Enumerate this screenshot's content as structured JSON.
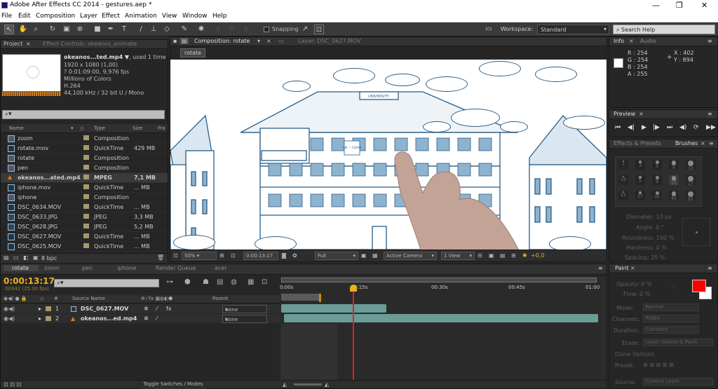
{
  "window": {
    "title": "Adobe After Effects CC 2014 - gestures.aep *",
    "min": "—",
    "max": "❐",
    "close": "✕"
  },
  "menu": [
    "File",
    "Edit",
    "Composition",
    "Layer",
    "Effect",
    "Animation",
    "View",
    "Window",
    "Help"
  ],
  "toolbar": {
    "snapping": "Snapping",
    "workspace_label": "Workspace:",
    "workspace_value": "Standard",
    "search_placeholder": "Search Help"
  },
  "project": {
    "tab": "Project",
    "tab2": "Effect Controls: okeanos_animate",
    "preview_name": "okeanos...ted.mp4 ▼",
    ",used": ", used 1 time",
    "info_lines": [
      "1920 x 1080 (1,00)",
      "? 0:01:09:00, 9,976 fps",
      "Millions of Colors",
      "H.264",
      "44,100 kHz / 32 bit U / Mono"
    ],
    "search_placeholder": "⌕▾",
    "headers": {
      "name": "Name",
      "type": "Type",
      "size": "Size",
      "frame": "Fra"
    },
    "items": [
      {
        "name": "zoom",
        "type": "Composition",
        "size": "",
        "icon": "comp",
        "color": "#a69a6a"
      },
      {
        "name": "rotate.mov",
        "type": "QuickTime",
        "size": "429 MB",
        "icon": "file",
        "color": "#a69a6a"
      },
      {
        "name": "rotate",
        "type": "Composition",
        "size": "",
        "icon": "comp",
        "color": "#a69a6a"
      },
      {
        "name": "pen",
        "type": "Composition",
        "size": "",
        "icon": "comp",
        "color": "#a69a6a"
      },
      {
        "name": "okeanos...ated.mp4",
        "type": "MPEG",
        "size": "7,1 MB",
        "icon": "vlc",
        "color": "#a69a6a"
      },
      {
        "name": "iphone.mov",
        "type": "QuickTime",
        "size": "... MB",
        "icon": "file",
        "color": "#a69a6a"
      },
      {
        "name": "iphone",
        "type": "Composition",
        "size": "",
        "icon": "comp",
        "color": "#a69a6a"
      },
      {
        "name": "DSC_0634.MOV",
        "type": "QuickTime",
        "size": "... MB",
        "icon": "file",
        "color": "#a69a6a"
      },
      {
        "name": "DSC_0633.JPG",
        "type": "JPEG",
        "size": "3,3 MB",
        "icon": "img",
        "color": "#a69a6a"
      },
      {
        "name": "DSC_0628.JPG",
        "type": "JPEG",
        "size": "5,2 MB",
        "icon": "img",
        "color": "#a69a6a"
      },
      {
        "name": "DSC_0627.MOV",
        "type": "QuickTime",
        "size": "... MB",
        "icon": "file",
        "color": "#a69a6a"
      },
      {
        "name": "DSC_0625.MOV",
        "type": "QuickTime",
        "size": "... MB",
        "icon": "file",
        "color": "#a69a6a"
      }
    ],
    "bpc": "8 bpc"
  },
  "composition": {
    "tab": "Composition: rotate",
    "layer_tab": "Layer: DSC_0627.MOV",
    "breadcrumb": "rotate",
    "zoom": "50%",
    "timecode": "0:00:13:17",
    "resolution": "Full",
    "camera": "Active Camera",
    "view": "1 View",
    "exposure": "+0,0",
    "sign_text": "UNIVERSITY",
    "window_sign": "WE ♡ CLEAN"
  },
  "info": {
    "tab": "Info",
    "tab2": "Audio",
    "r": "R : 254",
    "g": "G : 254",
    "b": "B : 254",
    "a": "A : 255",
    "x": "X : 402",
    "y": "Y : 894"
  },
  "preview": {
    "tab": "Preview"
  },
  "brushes": {
    "tab1": "Effects & Presets",
    "tab2": "Brushes",
    "sizes": [
      "1",
      "3",
      "5",
      "9",
      "13",
      "19",
      "5",
      "9",
      "13",
      "17",
      "21",
      "27",
      "35",
      "45",
      "65"
    ],
    "props": [
      "Diameter: 13 px",
      "Angle: 0 °",
      "Roundness: 100 %",
      "Hardness: 0 %",
      "Spacing: 25 %"
    ]
  },
  "paint": {
    "tab": "Paint",
    "opacity": "Opacity: 0 %",
    "flow": "Flow: 0 %",
    "mode_label": "Mode:",
    "mode_value": "Normal",
    "channels_label": "Channels:",
    "channels_value": "RGBA",
    "duration_label": "Duration:",
    "duration_value": "Constant",
    "erase_label": "Erase:",
    "erase_value": "Layer Source & Paint",
    "clone_label": "Clone Options",
    "preset_label": "Preset:",
    "source_label": "Source:",
    "source_value": "Current Layer",
    "swatch_fg": "#ff0000",
    "swatch_bg": "#ffffff"
  },
  "timeline": {
    "tabs": [
      "rotate",
      "zoom",
      "pen",
      "iphone",
      "Render Queue",
      "acer"
    ],
    "timecode": "0:00:13:17",
    "frames": "00342 (25.00 fps)",
    "headers": {
      "num": "#",
      "source": "Source Name",
      "parent": "Parent"
    },
    "layers": [
      {
        "num": "1",
        "name": "DSC_0627.MOV",
        "parent": "None"
      },
      {
        "num": "2",
        "name": "okeanos...ed.mp4",
        "parent": "None"
      }
    ],
    "ruler": [
      "0:00s",
      "0:15s",
      "00:30s",
      "00:45s",
      "01:00"
    ],
    "toggle": "Toggle Switches / Modes"
  }
}
